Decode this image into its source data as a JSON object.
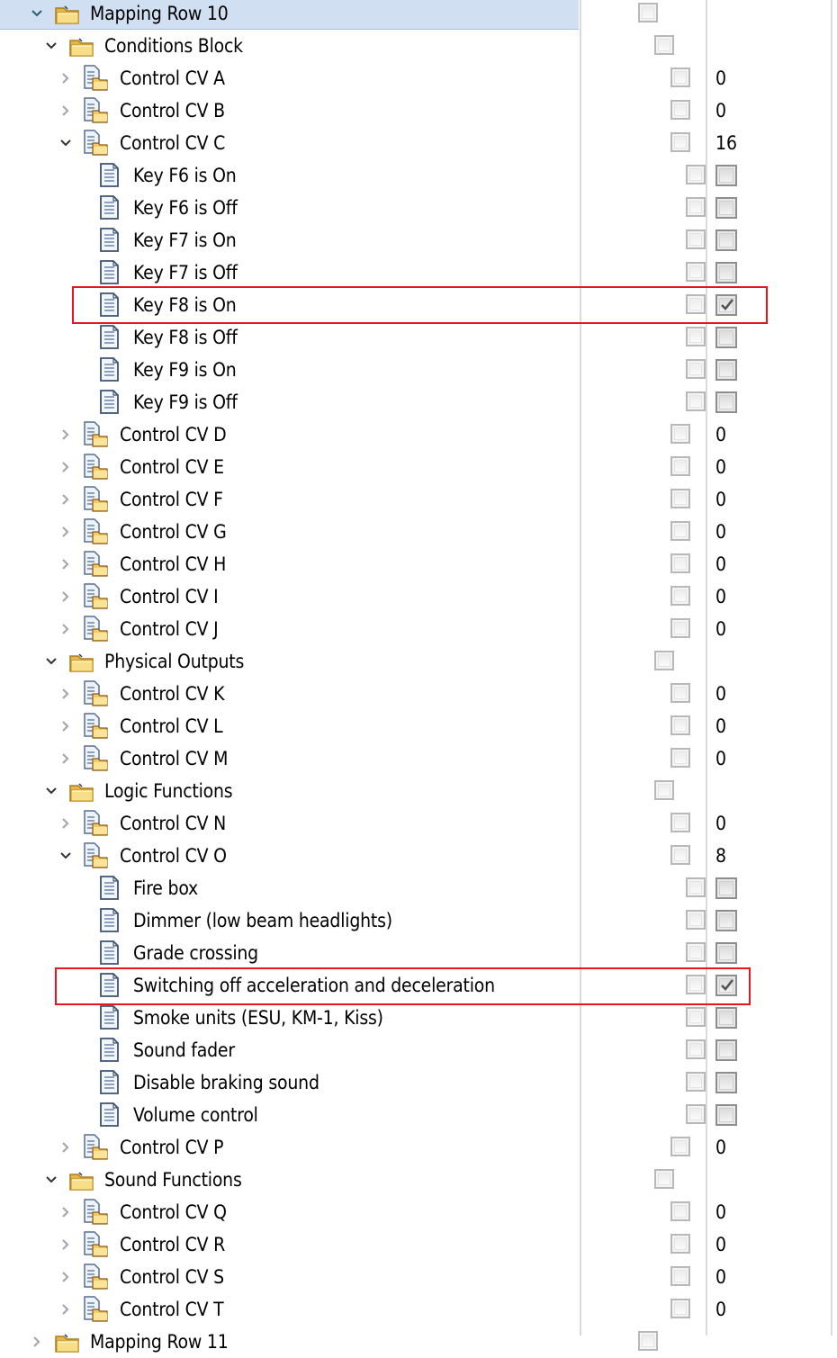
{
  "tree": {
    "rows": [
      {
        "label": "Mapping Row 10",
        "level": 0,
        "kind": "folder",
        "expander": "expanded",
        "checked_a": false,
        "selected": true
      },
      {
        "label": "Conditions Block",
        "level": 1,
        "kind": "folder",
        "expander": "expanded",
        "checked_a": false
      },
      {
        "label": "Control CV A",
        "level": 2,
        "kind": "cv",
        "expander": "collapsed",
        "checked_a": false,
        "value": "0"
      },
      {
        "label": "Control CV B",
        "level": 2,
        "kind": "cv",
        "expander": "collapsed",
        "checked_a": false,
        "value": "0"
      },
      {
        "label": "Control CV C",
        "level": 2,
        "kind": "cv",
        "expander": "expanded",
        "checked_a": false,
        "value": "16"
      },
      {
        "label": "Key F6 is On",
        "level": 3,
        "kind": "bit",
        "checked_a": false,
        "checked_b": false
      },
      {
        "label": "Key F6 is Off",
        "level": 3,
        "kind": "bit",
        "checked_a": false,
        "checked_b": false
      },
      {
        "label": "Key F7 is On",
        "level": 3,
        "kind": "bit",
        "checked_a": false,
        "checked_b": false
      },
      {
        "label": "Key F7 is Off",
        "level": 3,
        "kind": "bit",
        "checked_a": false,
        "checked_b": false
      },
      {
        "label": "Key F8 is On",
        "level": 3,
        "kind": "bit",
        "checked_a": false,
        "checked_b": true,
        "highlighted": true
      },
      {
        "label": "Key F8 is Off",
        "level": 3,
        "kind": "bit",
        "checked_a": false,
        "checked_b": false
      },
      {
        "label": "Key F9 is On",
        "level": 3,
        "kind": "bit",
        "checked_a": false,
        "checked_b": false
      },
      {
        "label": "Key F9 is Off",
        "level": 3,
        "kind": "bit",
        "checked_a": false,
        "checked_b": false
      },
      {
        "label": "Control CV D",
        "level": 2,
        "kind": "cv",
        "expander": "collapsed",
        "checked_a": false,
        "value": "0"
      },
      {
        "label": "Control CV E",
        "level": 2,
        "kind": "cv",
        "expander": "collapsed",
        "checked_a": false,
        "value": "0"
      },
      {
        "label": "Control CV F",
        "level": 2,
        "kind": "cv",
        "expander": "collapsed",
        "checked_a": false,
        "value": "0"
      },
      {
        "label": "Control CV G",
        "level": 2,
        "kind": "cv",
        "expander": "collapsed",
        "checked_a": false,
        "value": "0"
      },
      {
        "label": "Control CV H",
        "level": 2,
        "kind": "cv",
        "expander": "collapsed",
        "checked_a": false,
        "value": "0"
      },
      {
        "label": "Control CV I",
        "level": 2,
        "kind": "cv",
        "expander": "collapsed",
        "checked_a": false,
        "value": "0"
      },
      {
        "label": "Control CV J",
        "level": 2,
        "kind": "cv",
        "expander": "collapsed",
        "checked_a": false,
        "value": "0"
      },
      {
        "label": "Physical Outputs",
        "level": 1,
        "kind": "folder",
        "expander": "expanded",
        "checked_a": false
      },
      {
        "label": "Control CV K",
        "level": 2,
        "kind": "cv",
        "expander": "collapsed",
        "checked_a": false,
        "value": "0"
      },
      {
        "label": "Control CV L",
        "level": 2,
        "kind": "cv",
        "expander": "collapsed",
        "checked_a": false,
        "value": "0"
      },
      {
        "label": "Control CV M",
        "level": 2,
        "kind": "cv",
        "expander": "collapsed",
        "checked_a": false,
        "value": "0"
      },
      {
        "label": "Logic Functions",
        "level": 1,
        "kind": "folder",
        "expander": "expanded",
        "checked_a": false
      },
      {
        "label": "Control CV N",
        "level": 2,
        "kind": "cv",
        "expander": "collapsed",
        "checked_a": false,
        "value": "0"
      },
      {
        "label": "Control CV O",
        "level": 2,
        "kind": "cv",
        "expander": "expanded",
        "checked_a": false,
        "value": "8"
      },
      {
        "label": "Fire box",
        "level": 3,
        "kind": "bit",
        "checked_a": false,
        "checked_b": false
      },
      {
        "label": "Dimmer (low beam headlights)",
        "level": 3,
        "kind": "bit",
        "checked_a": false,
        "checked_b": false
      },
      {
        "label": "Grade crossing",
        "level": 3,
        "kind": "bit",
        "checked_a": false,
        "checked_b": false
      },
      {
        "label": "Switching off acceleration and deceleration",
        "level": 3,
        "kind": "bit",
        "checked_a": false,
        "checked_b": true,
        "highlighted": true
      },
      {
        "label": "Smoke units (ESU, KM-1, Kiss)",
        "level": 3,
        "kind": "bit",
        "checked_a": false,
        "checked_b": false
      },
      {
        "label": "Sound fader",
        "level": 3,
        "kind": "bit",
        "checked_a": false,
        "checked_b": false
      },
      {
        "label": "Disable braking sound",
        "level": 3,
        "kind": "bit",
        "checked_a": false,
        "checked_b": false
      },
      {
        "label": "Volume control",
        "level": 3,
        "kind": "bit",
        "checked_a": false,
        "checked_b": false
      },
      {
        "label": "Control CV P",
        "level": 2,
        "kind": "cv",
        "expander": "collapsed",
        "checked_a": false,
        "value": "0"
      },
      {
        "label": "Sound Functions",
        "level": 1,
        "kind": "folder",
        "expander": "expanded",
        "checked_a": false
      },
      {
        "label": "Control CV Q",
        "level": 2,
        "kind": "cv",
        "expander": "collapsed",
        "checked_a": false,
        "value": "0"
      },
      {
        "label": "Control CV R",
        "level": 2,
        "kind": "cv",
        "expander": "collapsed",
        "checked_a": false,
        "value": "0"
      },
      {
        "label": "Control CV S",
        "level": 2,
        "kind": "cv",
        "expander": "collapsed",
        "checked_a": false,
        "value": "0"
      },
      {
        "label": "Control CV T",
        "level": 2,
        "kind": "cv",
        "expander": "collapsed",
        "checked_a": false,
        "value": "0"
      },
      {
        "label": "Mapping Row 11",
        "level": 0,
        "kind": "folder",
        "expander": "collapsed",
        "checked_a": false
      }
    ]
  },
  "colors": {
    "selection": "#d0dff2",
    "annotation_box": "#e8141e"
  }
}
